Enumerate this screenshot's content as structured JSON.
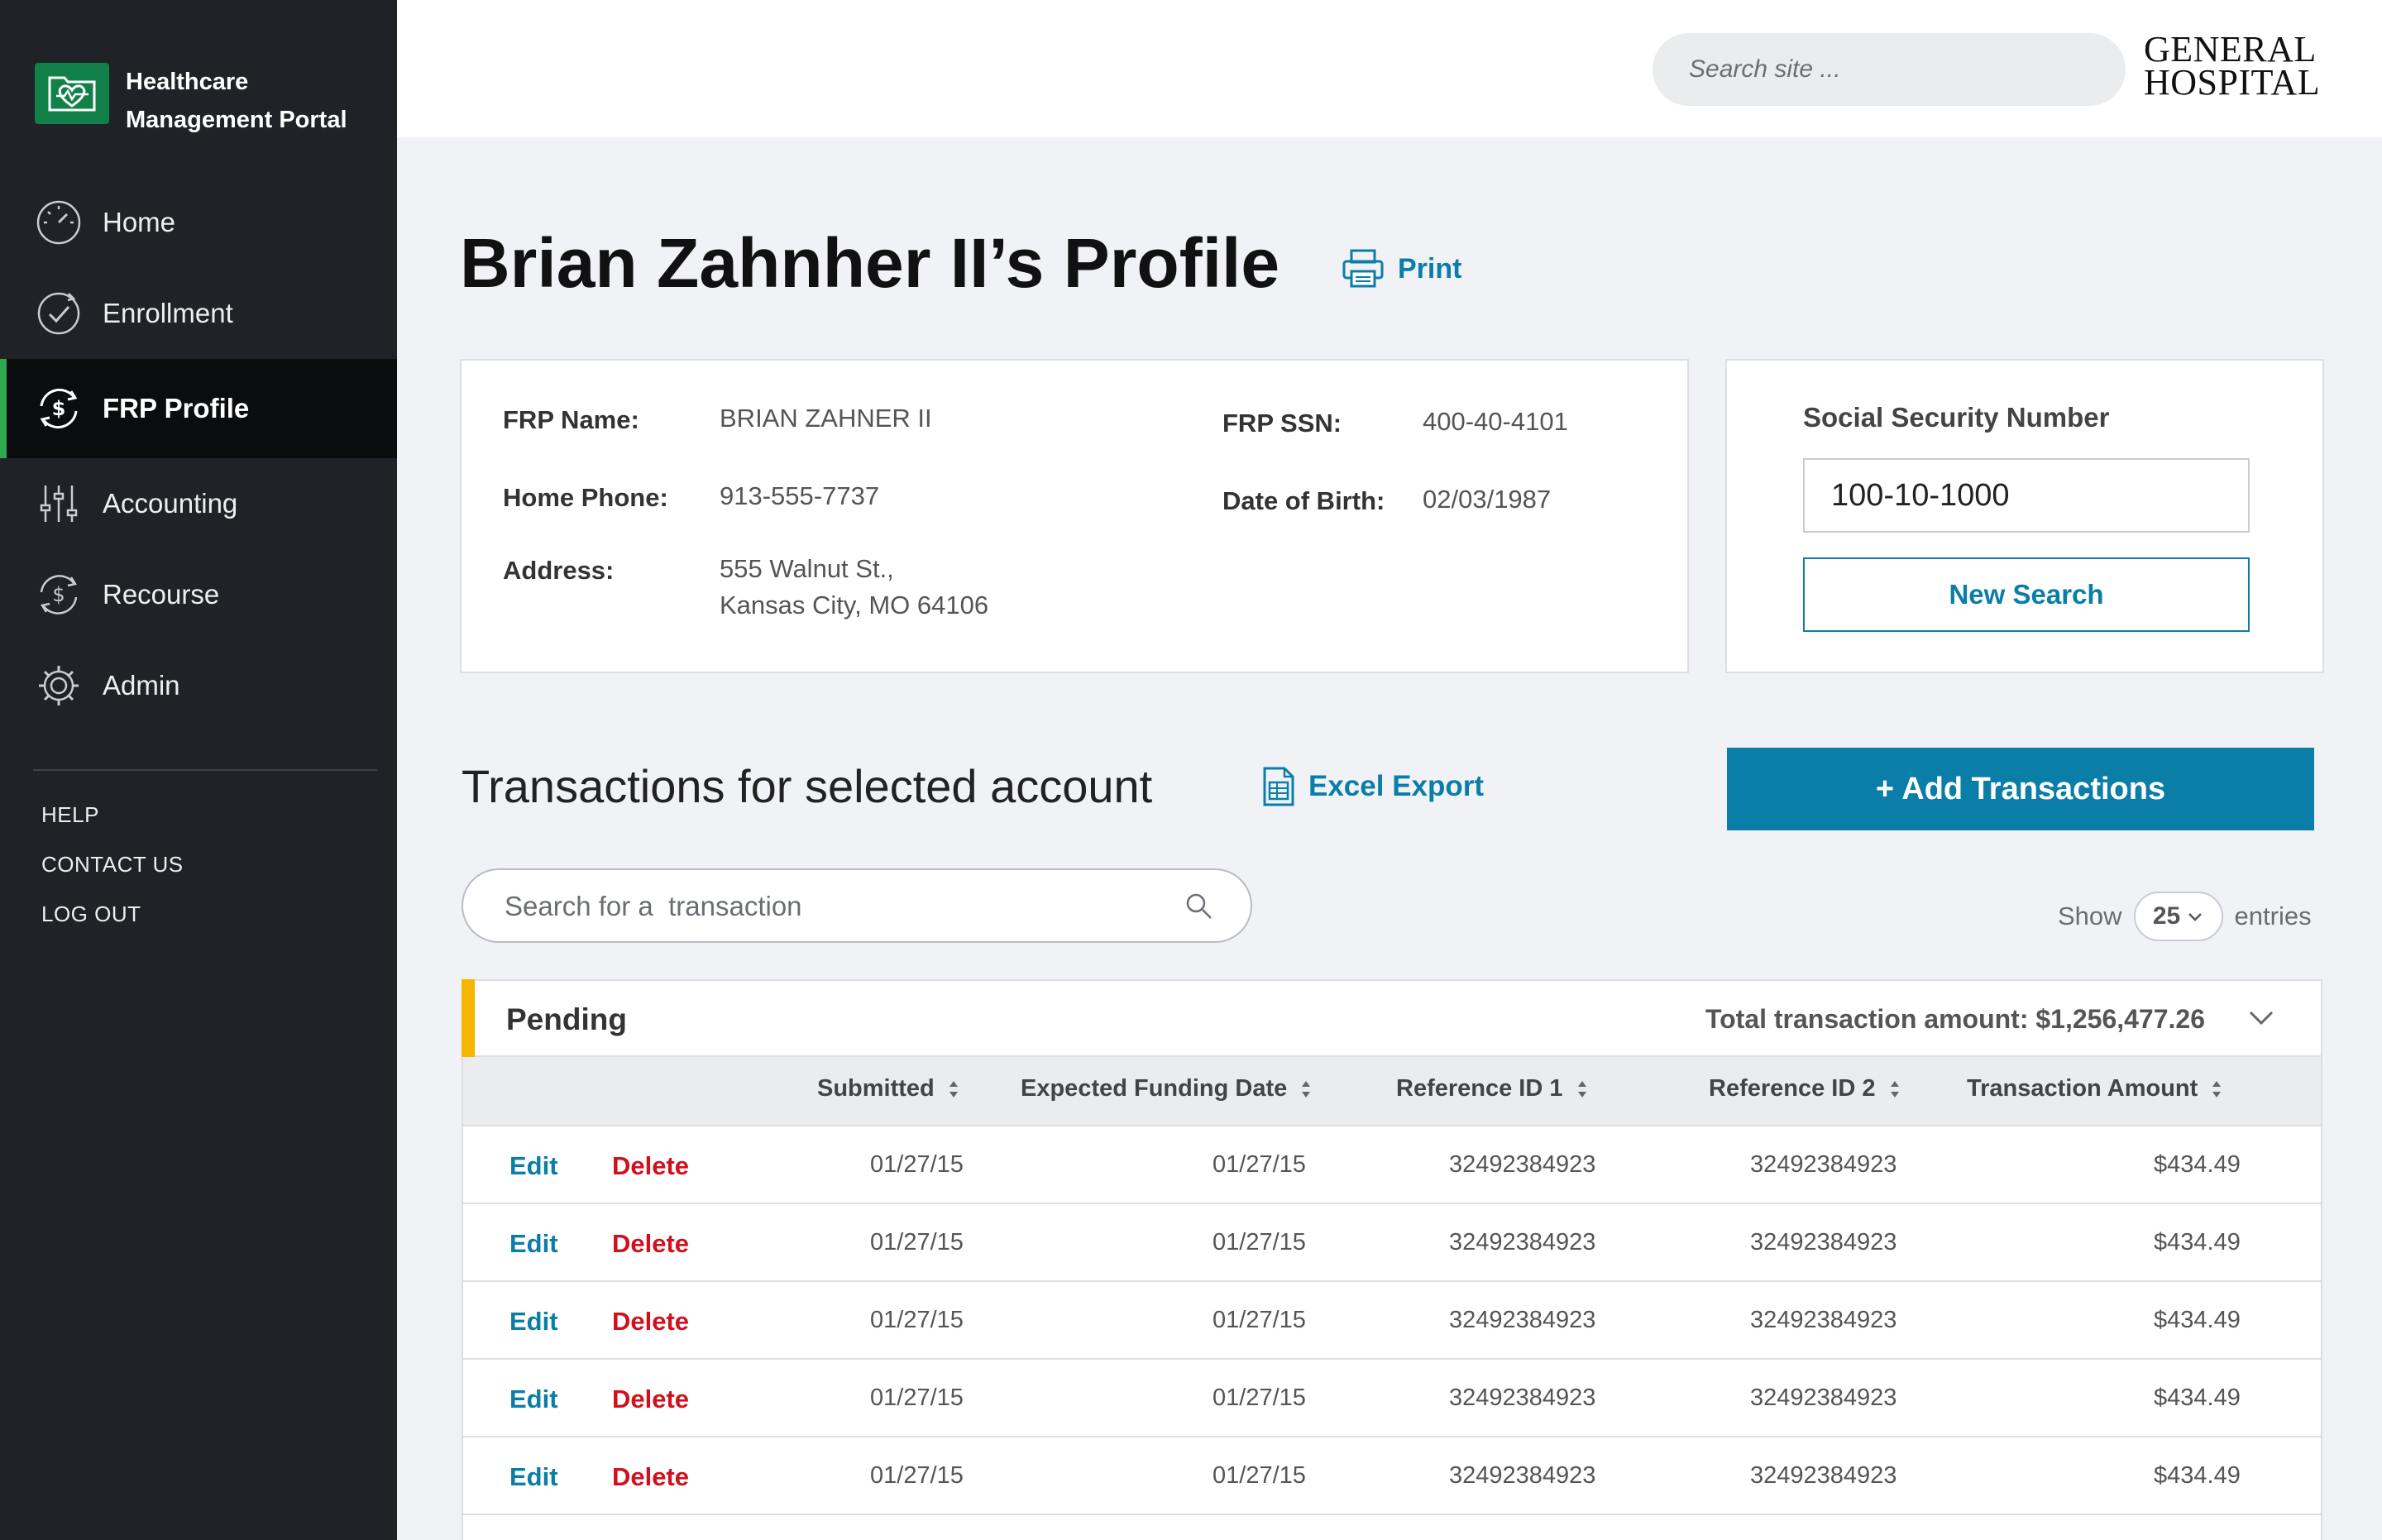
{
  "sidebar": {
    "brand_line1": "Healthcare",
    "brand_line2": "Management Portal",
    "nav": [
      {
        "label": "Home",
        "icon": "gauge-icon"
      },
      {
        "label": "Enrollment",
        "icon": "check-circle-icon"
      },
      {
        "label": "FRP Profile",
        "icon": "dollar-cycle-icon",
        "active": true
      },
      {
        "label": "Accounting",
        "icon": "sliders-icon"
      },
      {
        "label": "Recourse",
        "icon": "dollar-cycle-icon"
      },
      {
        "label": "Admin",
        "icon": "gear-icon"
      }
    ],
    "footer_links": [
      "HELP",
      "CONTACT US",
      "LOG OUT"
    ]
  },
  "header": {
    "search_placeholder": "Search site ...",
    "logo_line1": "GENERAL",
    "logo_line2": "HOSPITAL"
  },
  "page": {
    "title": "Brian Zahnher II’s Profile",
    "print_label": "Print"
  },
  "profile": {
    "frp_name_label": "FRP Name:",
    "frp_name": "BRIAN ZAHNER II",
    "home_phone_label": "Home Phone:",
    "home_phone": "913-555-7737",
    "address_label": "Address:",
    "address_line1": "555 Walnut St.,",
    "address_line2": "Kansas City, MO 64106",
    "ssn_label": "FRP SSN:",
    "ssn": "400-40-4101",
    "dob_label": "Date of Birth:",
    "dob": "02/03/1987"
  },
  "ssn_search": {
    "title": "Social Security Number",
    "value": "100-10-1000",
    "button": "New Search"
  },
  "transactions": {
    "heading": "Transactions for selected account",
    "excel_export": "Excel Export",
    "add_button": "+ Add Transactions",
    "search_placeholder": "Search for a  transaction",
    "show_label": "Show",
    "entries_value": "25",
    "entries_label": "entries",
    "group_label": "Pending",
    "total_label": "Total transaction amount: $1,256,477.26",
    "columns": [
      "Submitted",
      "Expected Funding Date",
      "Reference ID 1",
      "Reference ID 2",
      "Transaction Amount"
    ],
    "edit_label": "Edit",
    "delete_label": "Delete",
    "rows": [
      {
        "submitted": "01/27/15",
        "funding": "01/27/15",
        "ref1": "32492384923",
        "ref2": "32492384923",
        "amount": "$434.49"
      },
      {
        "submitted": "01/27/15",
        "funding": "01/27/15",
        "ref1": "32492384923",
        "ref2": "32492384923",
        "amount": "$434.49"
      },
      {
        "submitted": "01/27/15",
        "funding": "01/27/15",
        "ref1": "32492384923",
        "ref2": "32492384923",
        "amount": "$434.49"
      },
      {
        "submitted": "01/27/15",
        "funding": "01/27/15",
        "ref1": "32492384923",
        "ref2": "32492384923",
        "amount": "$434.49"
      },
      {
        "submitted": "01/27/15",
        "funding": "01/27/15",
        "ref1": "32492384923",
        "ref2": "32492384923",
        "amount": "$434.49"
      }
    ]
  },
  "colors": {
    "sidebar_bg": "#1f2227",
    "accent_blue": "#0a7ea6",
    "active_green": "#2fa84f",
    "brand_green": "#128049",
    "pending_yellow": "#f5b500",
    "delete_red": "#d0101d"
  }
}
